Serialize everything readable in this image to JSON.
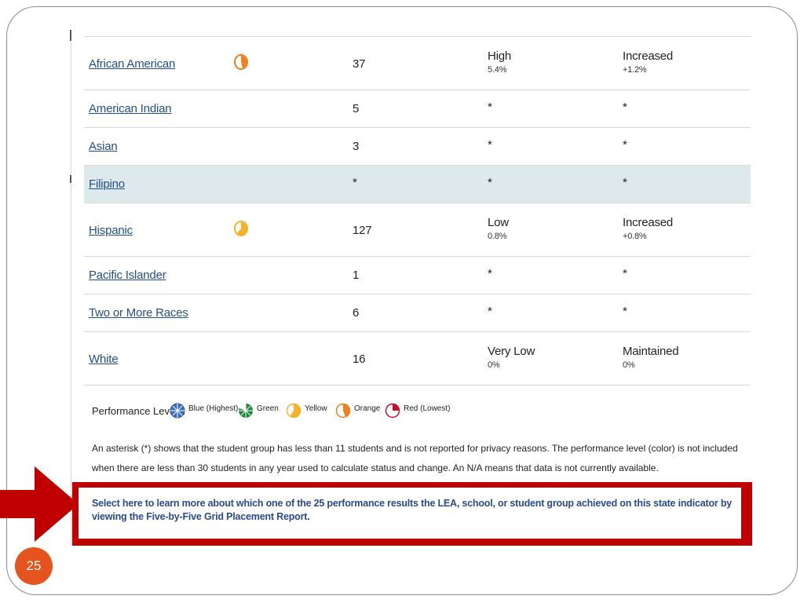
{
  "rows": [
    {
      "name": "African American",
      "gauge": "orange-gauge-icon",
      "count": "37",
      "status": "High",
      "status_pct": "5.4%",
      "change": "Increased",
      "change_pct": "+1.2%"
    },
    {
      "name": "American Indian",
      "count": "5",
      "status": "*",
      "change": "*"
    },
    {
      "name": "Asian",
      "count": "3",
      "status": "*",
      "change": "*"
    },
    {
      "name": "Filipino",
      "count": "*",
      "status": "*",
      "change": "*"
    },
    {
      "name": "Hispanic",
      "gauge": "yellow-gauge-icon",
      "count": "127",
      "status": "Low",
      "status_pct": "0.8%",
      "change": "Increased",
      "change_pct": "+0.8%"
    },
    {
      "name": "Pacific Islander",
      "count": "1",
      "status": "*",
      "change": "*"
    },
    {
      "name": "Two or More Races",
      "count": "6",
      "status": "*",
      "change": "*"
    },
    {
      "name": "White",
      "count": "16",
      "status": "Very Low",
      "status_pct": "0%",
      "change": "Maintained",
      "change_pct": "0%"
    }
  ],
  "legend": {
    "label": "Performance Levels:",
    "items": [
      {
        "label": "Blue (Highest)",
        "icon": "blue-gauge-icon",
        "color": "#3a6fc4"
      },
      {
        "label": "Green",
        "icon": "green-gauge-icon",
        "color": "#1f8a3a"
      },
      {
        "label": "Yellow",
        "icon": "yellow-gauge-icon",
        "color": "#f2b22a"
      },
      {
        "label": "Orange",
        "icon": "orange-gauge-icon",
        "color": "#ef7f22"
      },
      {
        "label": "Red (Lowest)",
        "icon": "red-gauge-icon",
        "color": "#c8102e"
      }
    ]
  },
  "note": "An asterisk (*) shows that the student group has less than 11 students and is not reported for privacy reasons. The performance level (color) is not included when there are less than 30 students in any year used to calculate status and change. An N/A means that data is not currently available.",
  "callout": "Select here to learn more about which one of the 25 performance results the LEA, school, or student group achieved on this state indicator by viewing the Five-by-Five Grid Placement Report.",
  "slide_number": "25",
  "colors": {
    "accent_red": "#c00000",
    "badge_orange": "#e5541e",
    "link_blue": "#234e8c",
    "highlight_row": "#dde9ea"
  }
}
